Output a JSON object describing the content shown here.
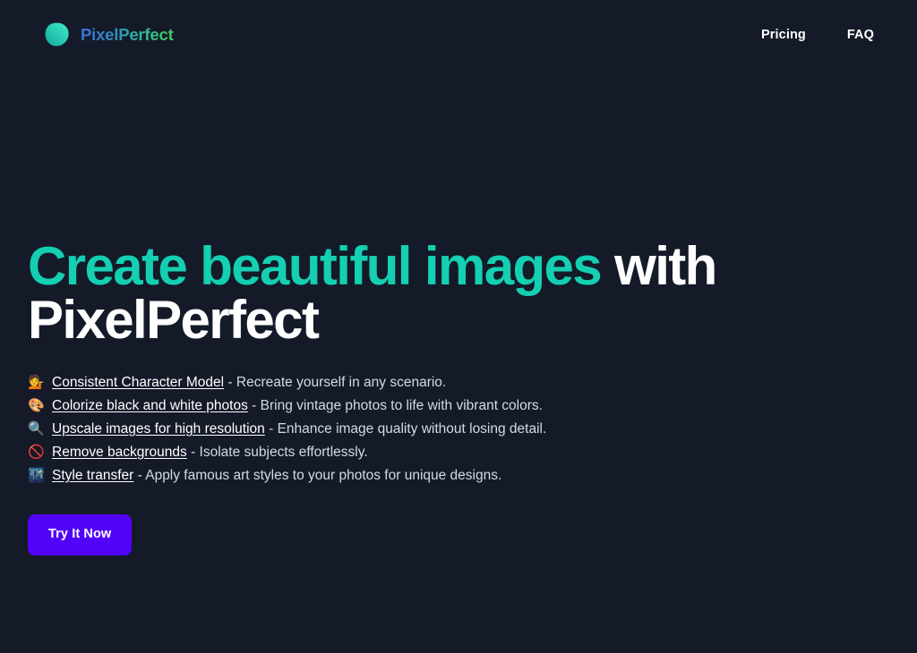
{
  "theme": {
    "background": "#141A28",
    "accent_teal": "#14CFB2",
    "cta_purple": "#5203FA",
    "body_text": "#d7dce5"
  },
  "header": {
    "brand": {
      "logo_icon": "blob-logo-icon",
      "name": "PixelPerfect",
      "gradient_from": "#3d6fd8",
      "gradient_to": "#3ecf5c"
    },
    "nav": [
      {
        "label": "Pricing"
      },
      {
        "label": "FAQ"
      }
    ]
  },
  "hero": {
    "title_accent": "Create beautiful images",
    "title_rest": " with PixelPerfect",
    "features": [
      {
        "emoji": "💁",
        "icon_name": "person-tipping-hand-emoji",
        "link": "Consistent Character Model",
        "desc": " - Recreate yourself in any scenario."
      },
      {
        "emoji": "🎨",
        "icon_name": "artist-palette-emoji",
        "link": "Colorize black and white photos",
        "desc": " - Bring vintage photos to life with vibrant colors."
      },
      {
        "emoji": "🔍",
        "icon_name": "magnifying-glass-emoji",
        "link": "Upscale images for high resolution",
        "desc": " - Enhance image quality without losing detail."
      },
      {
        "emoji": "🚫",
        "icon_name": "prohibited-sign-emoji",
        "link": "Remove backgrounds",
        "desc": " - Isolate subjects effortlessly."
      },
      {
        "emoji": "🌃",
        "icon_name": "night-with-stars-emoji",
        "link": "Style transfer",
        "desc": " - Apply famous art styles to your photos for unique designs."
      }
    ],
    "cta_label": "Try It Now"
  }
}
